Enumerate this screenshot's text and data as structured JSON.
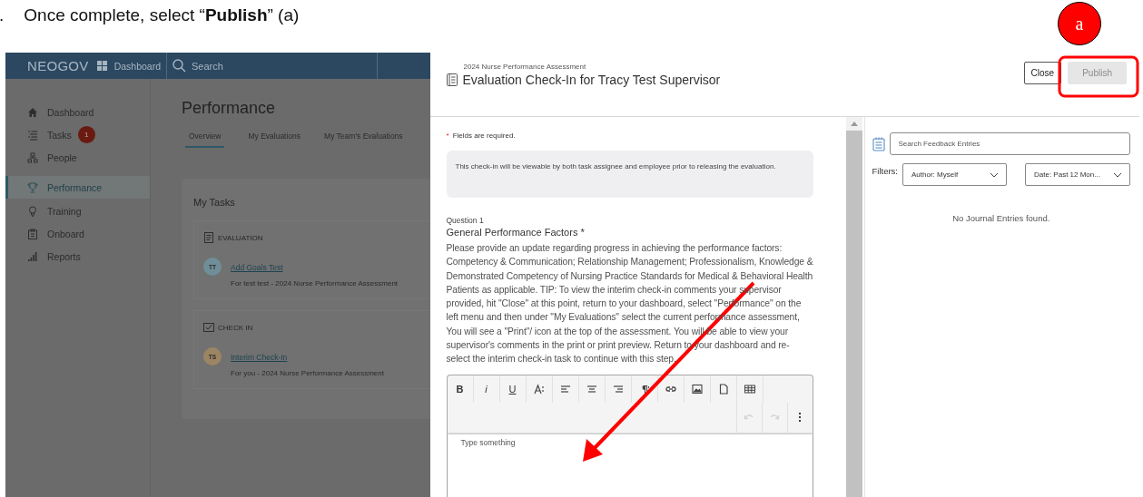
{
  "instruction": {
    "step": ".",
    "text": "Once complete, select “**Publish**” (a)"
  },
  "callout": {
    "label": "a"
  },
  "app": {
    "brand": "NEOGOV",
    "nav_link": "Dashboard",
    "search_placeholder": "Search",
    "sidebar": [
      {
        "label": "Dashboard",
        "selected": false
      },
      {
        "label": "Tasks",
        "badge": "1",
        "selected": false
      },
      {
        "label": "People",
        "selected": false
      },
      {
        "label": "Performance",
        "selected": true
      },
      {
        "label": "Training",
        "selected": false
      },
      {
        "label": "Onboard",
        "selected": false
      },
      {
        "label": "Reports",
        "selected": false
      }
    ],
    "page_title": "Performance",
    "tabs": [
      {
        "label": "Overview",
        "selected": true
      },
      {
        "label": "My Evaluations",
        "selected": false
      },
      {
        "label": "My Team's Evaluations",
        "selected": false
      }
    ],
    "tasks_title": "My Tasks",
    "task_groups": [
      {
        "heading": "EVALUATION",
        "items": [
          {
            "initials": "TT",
            "color": "#6f8e98",
            "title": "Add Goals Test",
            "subtitle": "For test test - 2024 Nurse Performance Assessment"
          }
        ]
      },
      {
        "heading": "CHECK IN",
        "items": [
          {
            "initials": "TS",
            "color": "#9c8563",
            "title": "Interim Check-In",
            "subtitle": "For you - 2024 Nurse Performance Assessment"
          }
        ]
      }
    ]
  },
  "modal": {
    "subtitle": "2024 Nurse Performance Assessment",
    "title": "Evaluation Check-In for Tracy Test Supervisor",
    "buttons": [
      {
        "label": "Close",
        "kind": "secondary",
        "disabled": false
      },
      {
        "label": "Publish",
        "kind": "primary",
        "disabled": true
      }
    ],
    "required_mark": "*",
    "required_note": "Fields are required.",
    "notice": "This check-in will be viewable by both task assignee and employee prior to releasing the evaluation.",
    "question": {
      "number": "Question 1",
      "title": "General Performance Factors *",
      "text": "Please provide an update regarding progress in achieving the performance factors: Competency & Communication; Relationship Management; Professionalism, Knowledge & Demonstrated Competency of Nursing Practice Standards for Medical & Behavioral Health Patients as applicable. TIP: To view the interim check-in comments your supervisor provided, hit \"Close\" at this point, return to your dashboard, select \"Performance\" on the left menu and then under \"My Evaluations\" select the current performance assessment, You will see a \"Print\"/ icon at the top of the assessment. You will be able to view your supervisor's comments in the print or print preview. Return to your dashboard and re-select the interim check-in task to continue with this step."
    },
    "toolbar": [
      {
        "kind": "text",
        "label": "B"
      },
      {
        "kind": "text",
        "label": "i"
      },
      {
        "kind": "text",
        "label": "U"
      },
      {
        "kind": "icon"
      },
      {
        "kind": "icon"
      },
      {
        "kind": "icon"
      },
      {
        "kind": "icon"
      },
      {
        "kind": "icon"
      },
      {
        "kind": "icon"
      },
      {
        "kind": "icon"
      },
      {
        "kind": "icon"
      },
      {
        "kind": "icon"
      }
    ],
    "toolbar_row2": [
      {
        "disabled": true
      },
      {
        "disabled": true
      },
      {
        "disabled": false
      }
    ],
    "editor": {
      "placeholder": "Type something"
    },
    "feedback": {
      "search_placeholder": "Search Feedback Entries",
      "filters_label": "Filters:",
      "filters": [
        {
          "label": "Author: Myself"
        },
        {
          "label": "Date: Past 12 Mon..."
        }
      ],
      "empty": "No Journal Entries found."
    }
  }
}
